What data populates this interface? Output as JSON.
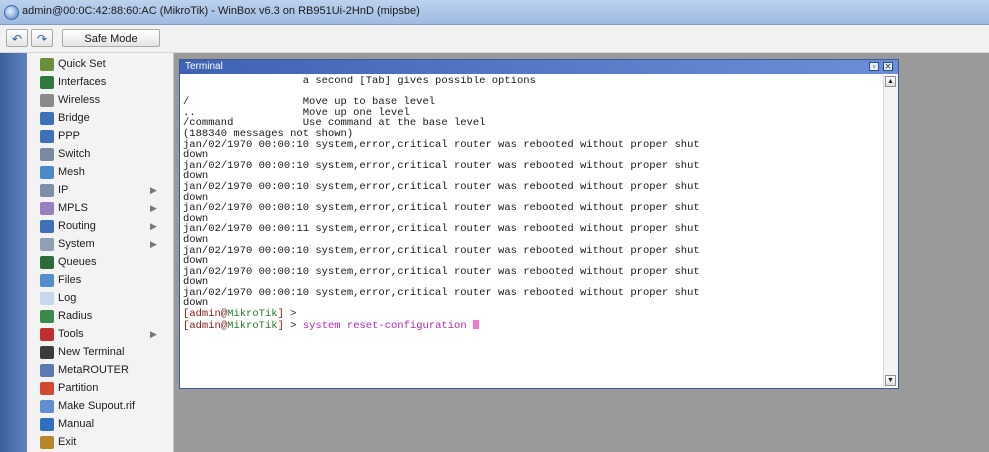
{
  "window": {
    "title": "admin@00:0C:42:88:60:AC (MikroTik) - WinBox v6.3 on RB951Ui-2HnD (mipsbe)"
  },
  "toolbar": {
    "undo_label": "↶",
    "redo_label": "↷",
    "safe_mode_label": "Safe Mode"
  },
  "sidebar": {
    "items": [
      {
        "label": "Quick Set",
        "icon": "quickset-icon",
        "has_submenu": false
      },
      {
        "label": "Interfaces",
        "icon": "interfaces-icon",
        "has_submenu": false
      },
      {
        "label": "Wireless",
        "icon": "wireless-icon",
        "has_submenu": false
      },
      {
        "label": "Bridge",
        "icon": "bridge-icon",
        "has_submenu": false
      },
      {
        "label": "PPP",
        "icon": "ppp-icon",
        "has_submenu": false
      },
      {
        "label": "Switch",
        "icon": "switch-icon",
        "has_submenu": false
      },
      {
        "label": "Mesh",
        "icon": "mesh-icon",
        "has_submenu": false
      },
      {
        "label": "IP",
        "icon": "ip-icon",
        "has_submenu": true
      },
      {
        "label": "MPLS",
        "icon": "mpls-icon",
        "has_submenu": true
      },
      {
        "label": "Routing",
        "icon": "routing-icon",
        "has_submenu": true
      },
      {
        "label": "System",
        "icon": "system-icon",
        "has_submenu": true
      },
      {
        "label": "Queues",
        "icon": "queues-icon",
        "has_submenu": false
      },
      {
        "label": "Files",
        "icon": "files-icon",
        "has_submenu": false
      },
      {
        "label": "Log",
        "icon": "log-icon",
        "has_submenu": false
      },
      {
        "label": "Radius",
        "icon": "radius-icon",
        "has_submenu": false
      },
      {
        "label": "Tools",
        "icon": "tools-icon",
        "has_submenu": true
      },
      {
        "label": "New Terminal",
        "icon": "terminal-icon",
        "has_submenu": false
      },
      {
        "label": "MetaROUTER",
        "icon": "metarouter-icon",
        "has_submenu": false
      },
      {
        "label": "Partition",
        "icon": "partition-icon",
        "has_submenu": false
      },
      {
        "label": "Make Supout.rif",
        "icon": "supout-icon",
        "has_submenu": false
      },
      {
        "label": "Manual",
        "icon": "manual-icon",
        "has_submenu": false
      },
      {
        "label": "Exit",
        "icon": "exit-icon",
        "has_submenu": false
      }
    ]
  },
  "terminal": {
    "title": "Terminal",
    "lines": [
      "                   a second [Tab] gives possible options",
      "",
      "/                  Move up to base level",
      "..                 Move up one level",
      "/command           Use command at the base level",
      "(188340 messages not shown)",
      "jan/02/1970 00:00:10 system,error,critical router was rebooted without proper shut",
      "down",
      "jan/02/1970 00:00:10 system,error,critical router was rebooted without proper shut",
      "down",
      "jan/02/1970 00:00:10 system,error,critical router was rebooted without proper shut",
      "down",
      "jan/02/1970 00:00:10 system,error,critical router was rebooted without proper shut",
      "down",
      "jan/02/1970 00:00:11 system,error,critical router was rebooted without proper shut",
      "down",
      "jan/02/1970 00:00:10 system,error,critical router was rebooted without proper shut",
      "down",
      "jan/02/1970 00:00:10 system,error,critical router was rebooted without proper shut",
      "down",
      "jan/02/1970 00:00:10 system,error,critical router was rebooted without proper shut",
      "down"
    ],
    "prompt_user": "admin",
    "prompt_host": "MikroTik",
    "prompt_line_1": " >",
    "prompt_line_2_cmd": "system reset-configuration"
  },
  "colors": {
    "accent": "#3f63b3",
    "cursor": "#f07ad0",
    "command": "#b02ab0"
  }
}
